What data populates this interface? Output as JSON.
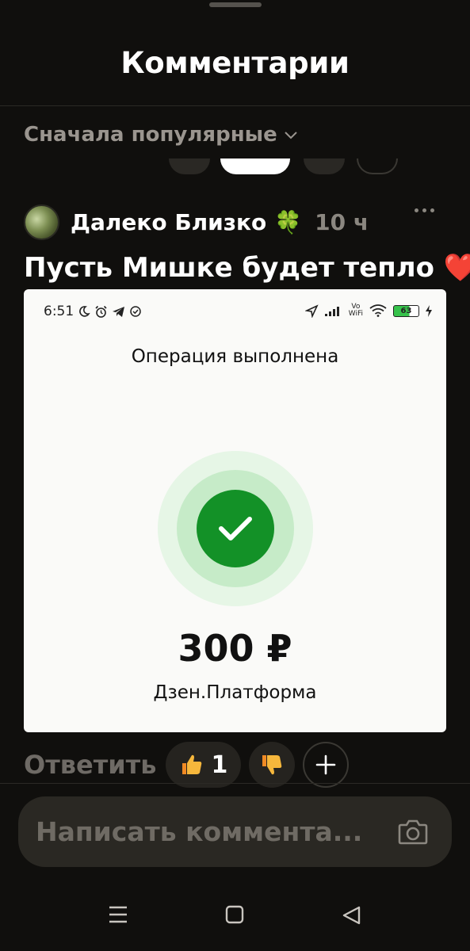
{
  "header": {
    "title": "Комментарии"
  },
  "sort": {
    "label": "Сначала популярные",
    "icon": "chevron-down-icon"
  },
  "comment": {
    "author": "Далеко Близко",
    "author_badge": "🍀",
    "time": "10 ч",
    "text": "Пусть Мишке будет тепло",
    "text_emoji": "❤️",
    "attachment": {
      "status_time": "6:51",
      "battery": "63",
      "vowifi_top": "Vo",
      "vowifi_bottom": "WiFi",
      "title": "Операция выполнена",
      "amount": "300 ₽",
      "merchant": "Дзен.Платформа"
    },
    "actions": {
      "reply_label": "Ответить",
      "like_count": "1"
    }
  },
  "input": {
    "placeholder": "Написать коммента..."
  },
  "colors": {
    "background": "#100f0d",
    "success_green": "#139127",
    "muted": "#8b8780"
  }
}
